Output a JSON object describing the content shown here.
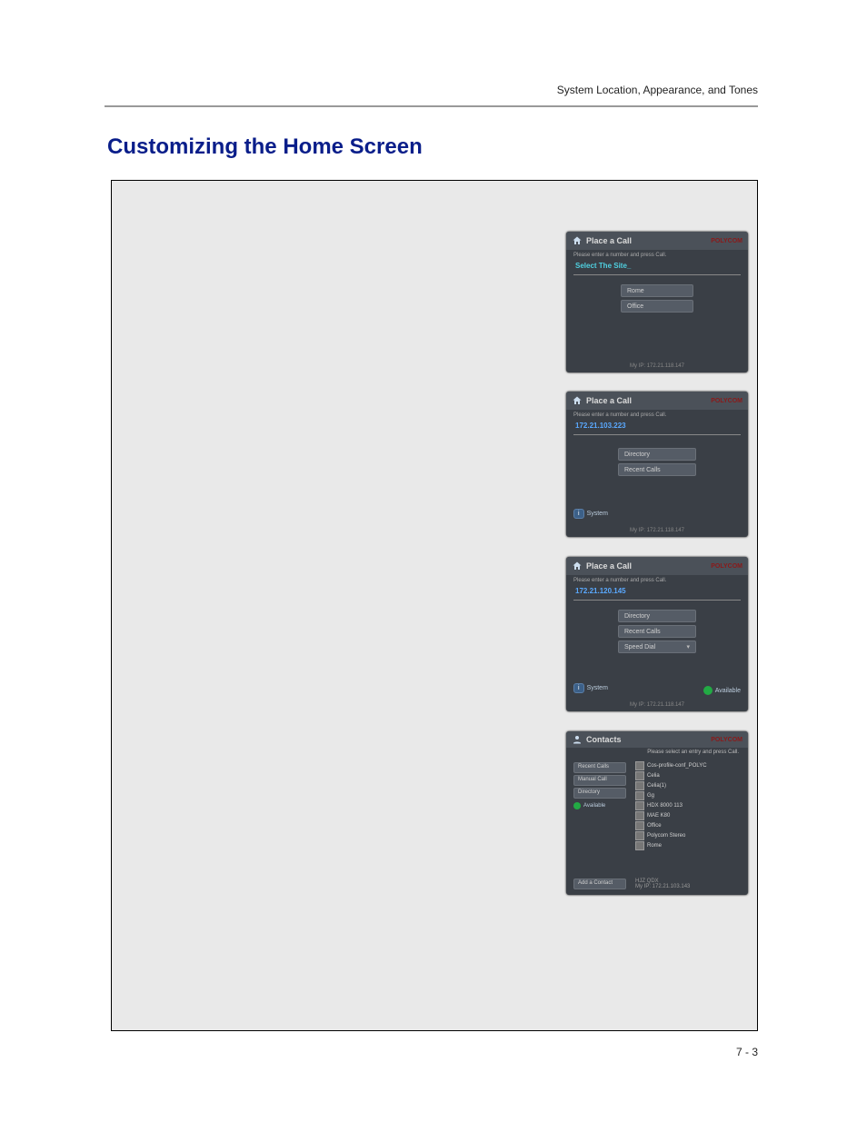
{
  "header": "System Location, Appearance, and Tones",
  "title": "Customizing the Home Screen",
  "page_num": "7 - 3",
  "logo": "POLYCOM",
  "screen1": {
    "title": "Place a Call",
    "prompt": "Please enter a number and press Call.",
    "input": "Select The Site_",
    "btn1": "Rome",
    "btn2": "Office",
    "footer": "My IP: 172.21.118.147"
  },
  "screen2": {
    "title": "Place a Call",
    "prompt": "Please enter a number and press Call.",
    "input": "172.21.103.223",
    "btn1": "Directory",
    "btn2": "Recent Calls",
    "sys": "System",
    "footer": "My IP: 172.21.118.147"
  },
  "screen3": {
    "title": "Place a Call",
    "prompt": "Please enter a number and press Call.",
    "input": "172.21.120.145",
    "btn1": "Directory",
    "btn2": "Recent Calls",
    "btn3": "Speed Dial",
    "sys": "System",
    "avail": "Available",
    "footer": "My IP: 172.21.118.147"
  },
  "screen4": {
    "title": "Contacts",
    "prompt": "Please select an entry and press Call.",
    "side": {
      "recent": "Recent Calls",
      "manual": "Manual Call",
      "dir": "Directory",
      "avail": "Available"
    },
    "list": [
      "Cos-profile-conf_POLYC",
      "Celia",
      "Celia(1)",
      "Gg",
      "HDX 8000 113",
      "MAE K80",
      "Office",
      "Polycom Stereo",
      "Rome"
    ],
    "add": "Add a Contact",
    "ext": "HJZ QDX",
    "footer": "My IP: 172.21.103.143"
  }
}
